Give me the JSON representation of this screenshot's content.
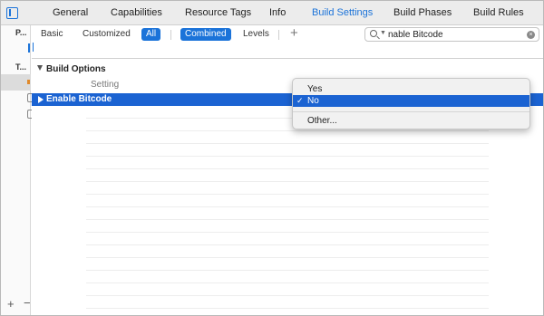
{
  "tabs": [
    {
      "label": "General"
    },
    {
      "label": "Capabilities"
    },
    {
      "label": "Resource Tags"
    },
    {
      "label": "Info"
    },
    {
      "label": "Build Settings",
      "active": true
    },
    {
      "label": "Build Phases"
    },
    {
      "label": "Build Rules"
    }
  ],
  "navigator": {
    "project_label": "P...",
    "targets_label": "T..."
  },
  "filter": {
    "basic": "Basic",
    "customized": "Customized",
    "all": "All",
    "combined": "Combined",
    "levels": "Levels",
    "add": "+"
  },
  "search": {
    "value": "nable Bitcode",
    "clear": "×"
  },
  "section": {
    "title": "Build Options",
    "column_setting": "Setting"
  },
  "selected_row": {
    "name": "Enable Bitcode"
  },
  "popup": {
    "options": [
      "Yes",
      "No",
      "Other..."
    ],
    "selected": "No",
    "check": "✓"
  },
  "footer": {
    "add": "+",
    "remove": "−"
  },
  "colors": {
    "accent": "#1b73d9",
    "selection": "#1b63d2"
  }
}
